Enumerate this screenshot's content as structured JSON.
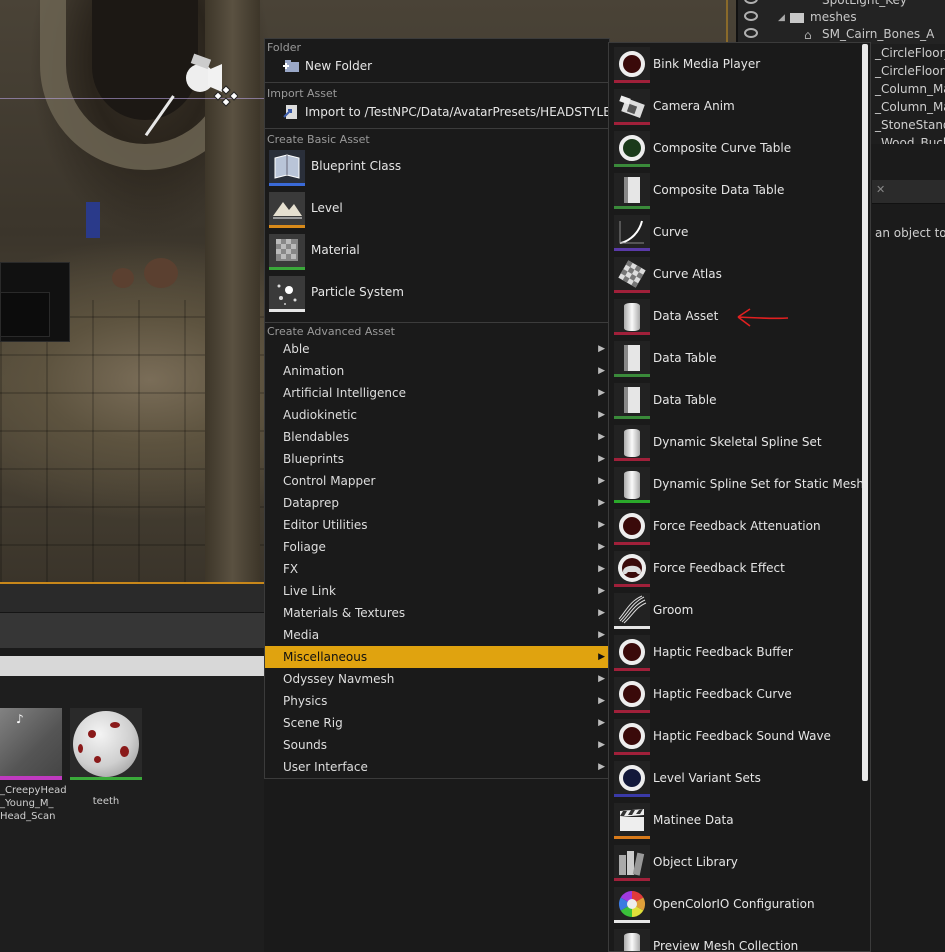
{
  "outliner": {
    "rows": [
      "SpotLight_Key",
      "meshes",
      "SM_Cairn_Bones_A"
    ],
    "list": [
      "_CircleFloor_A",
      "_CircleFloorSt",
      "_Column_Mai",
      "_Column_Mai",
      "_StoneStand",
      "_Wood_Bucket"
    ]
  },
  "details": {
    "hint": "an object to v"
  },
  "content_browser": {
    "thumbs": [
      {
        "label": "_CreepyHead\n_Young_M_\nHead_Scan"
      },
      {
        "label": "teeth"
      }
    ]
  },
  "menu": {
    "sections": {
      "folder": "Folder",
      "import": "Import Asset",
      "basic": "Create Basic Asset",
      "advanced": "Create Advanced Asset"
    },
    "new_folder": "New Folder",
    "import_to": "Import to /TestNPC/Data/AvatarPresets/HEADSTYLE...",
    "basic_items": [
      {
        "label": "Blueprint Class",
        "color": "#3a6ad8"
      },
      {
        "label": "Level",
        "color": "#d88a1a"
      },
      {
        "label": "Material",
        "color": "#3aa83a"
      },
      {
        "label": "Particle System",
        "color": "#e6e6e6"
      }
    ],
    "categories": [
      "Able",
      "Animation",
      "Artificial Intelligence",
      "Audiokinetic",
      "Blendables",
      "Blueprints",
      "Control Mapper",
      "Dataprep",
      "Editor Utilities",
      "Foliage",
      "FX",
      "Live Link",
      "Materials & Textures",
      "Media",
      "Miscellaneous",
      "Odyssey Navmesh",
      "Physics",
      "Scene Rig",
      "Sounds",
      "User Interface"
    ],
    "active_category": "Miscellaneous",
    "accent": "#e0a30f"
  },
  "submenu": {
    "items": [
      {
        "label": "Bink Media Player",
        "icon": "ring-dark",
        "color": "#a0203a"
      },
      {
        "label": "Camera Anim",
        "icon": "camera-icon",
        "color": "#a0203a"
      },
      {
        "label": "Composite Curve Table",
        "icon": "ring-green",
        "color": "#3a8a3a"
      },
      {
        "label": "Composite Data Table",
        "icon": "doc",
        "color": "#3a8a3a"
      },
      {
        "label": "Curve",
        "icon": "curve-icon",
        "color": "#5a3aa8"
      },
      {
        "label": "Curve Atlas",
        "icon": "checker-icon",
        "color": "#a0203a"
      },
      {
        "label": "Data Asset",
        "icon": "cylinder",
        "color": "#a0203a"
      },
      {
        "label": "Data Table",
        "icon": "doc",
        "color": "#3a8a3a"
      },
      {
        "label": "Data Table",
        "icon": "doc",
        "color": "#3a8a3a"
      },
      {
        "label": "Dynamic Skeletal Spline Set",
        "icon": "cylinder",
        "color": "#a0203a"
      },
      {
        "label": "Dynamic Spline Set for Static Mesh",
        "icon": "cylinder",
        "color": "#2aa82a"
      },
      {
        "label": "Force Feedback Attenuation",
        "icon": "ring-dark",
        "color": "#a0203a"
      },
      {
        "label": "Force Feedback Effect",
        "icon": "gamepad-icon",
        "color": "#a0203a"
      },
      {
        "label": "Groom",
        "icon": "hair-icon",
        "color": "#e6e6e6"
      },
      {
        "label": "Haptic Feedback Buffer",
        "icon": "ring-dark",
        "color": "#a0203a"
      },
      {
        "label": "Haptic Feedback Curve",
        "icon": "ring-dark",
        "color": "#a0203a"
      },
      {
        "label": "Haptic Feedback Sound Wave",
        "icon": "ring-dark",
        "color": "#a0203a"
      },
      {
        "label": "Level Variant Sets",
        "icon": "ring-navy",
        "color": "#3a3aa8"
      },
      {
        "label": "Matinee Data",
        "icon": "clapper-icon",
        "color": "#d87a1a"
      },
      {
        "label": "Object Library",
        "icon": "books-icon",
        "color": "#a0203a"
      },
      {
        "label": "OpenColorIO Configuration",
        "icon": "color-wheel-icon",
        "color": "#e6e6e6"
      },
      {
        "label": "Preview Mesh Collection",
        "icon": "cylinder",
        "color": "#a0203a"
      }
    ]
  }
}
